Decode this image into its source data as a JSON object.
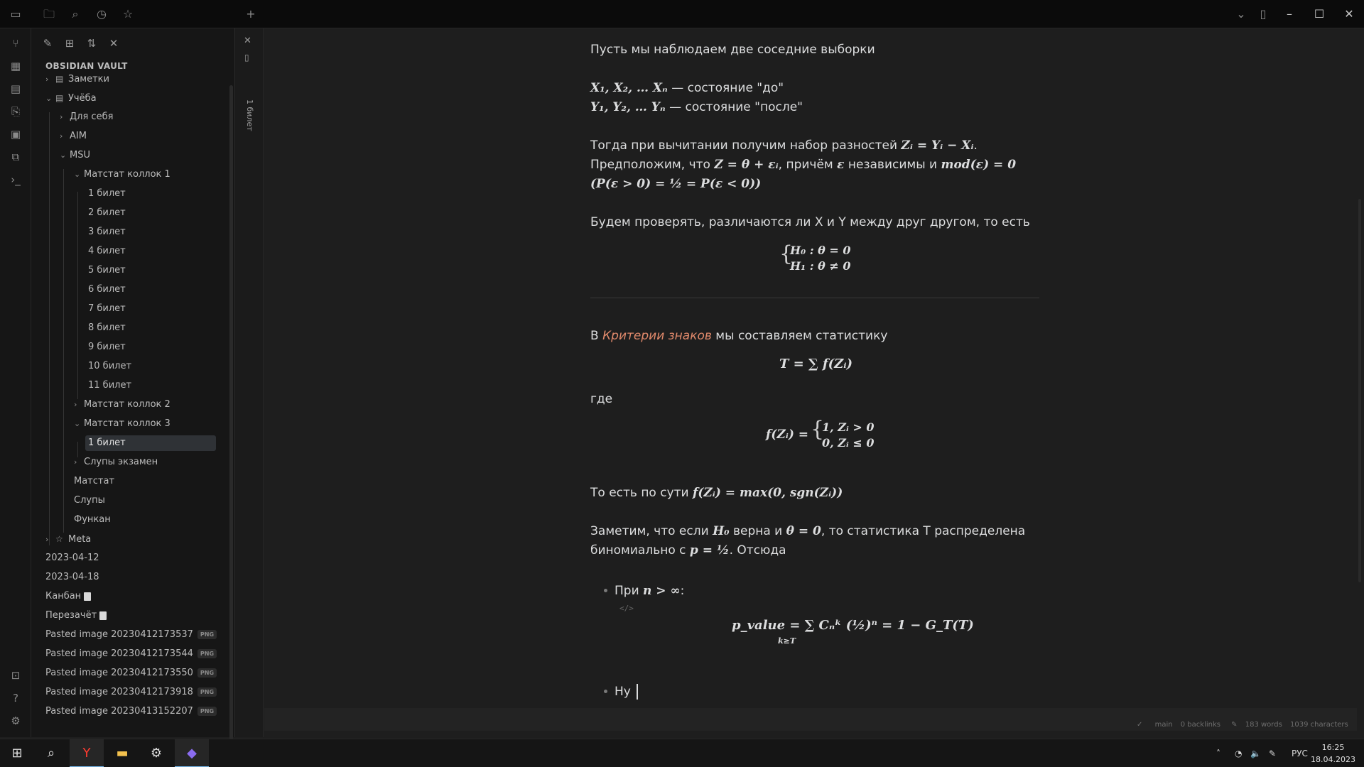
{
  "sidebar": {
    "vault_name": "OBSIDIAN VAULT",
    "tree": [
      {
        "label": "Заметки",
        "icon": "notebook-icon",
        "chev": "›"
      },
      {
        "label": "Учёба",
        "icon": "notebook-icon",
        "chev": "⌄"
      },
      {
        "label": "Для себя",
        "chev": "›"
      },
      {
        "label": "AIM",
        "chev": "›"
      },
      {
        "label": "MSU",
        "chev": "⌄"
      },
      {
        "label": "Матстат коллок 1",
        "chev": "⌄"
      },
      {
        "label": "1 билет"
      },
      {
        "label": "2 билет"
      },
      {
        "label": "3 билет"
      },
      {
        "label": "4 билет"
      },
      {
        "label": "5 билет"
      },
      {
        "label": "6 билет"
      },
      {
        "label": "7 билет"
      },
      {
        "label": "8 билет"
      },
      {
        "label": "9 билет"
      },
      {
        "label": "10 билет"
      },
      {
        "label": "11 билет"
      },
      {
        "label": "Матстат коллок 2",
        "chev": "›"
      },
      {
        "label": "Матстат коллок 3",
        "chev": "⌄"
      },
      {
        "label": "1 билет",
        "selected": true
      },
      {
        "label": "Слупы экзамен",
        "chev": "›"
      },
      {
        "label": "Матстат"
      },
      {
        "label": "Слупы"
      },
      {
        "label": "Функан"
      },
      {
        "label": "Meta",
        "icon": "star-icon",
        "chev": "›"
      },
      {
        "label": "2023-04-12"
      },
      {
        "label": "2023-04-18"
      },
      {
        "label": "Канбан"
      },
      {
        "label": "Перезачёт"
      },
      {
        "label": "Pasted image 20230412173537",
        "badge": "PNG"
      },
      {
        "label": "Pasted image 20230412173544",
        "badge": "PNG"
      },
      {
        "label": "Pasted image 20230412173550",
        "badge": "PNG"
      },
      {
        "label": "Pasted image 20230412173918",
        "badge": "PNG"
      },
      {
        "label": "Pasted image 20230413152207",
        "badge": "PNG"
      }
    ]
  },
  "tab": {
    "title": "1 билет"
  },
  "note": {
    "p1": "Пусть мы наблюдаем две соседние выборки",
    "x_seq": "X₁, X₂, … Xₙ",
    "x_text": " — состояние \"до\"",
    "y_seq": "Y₁, Y₂, … Yₙ",
    "y_text": " — состояние \"после\"",
    "p3a": "Тогда при вычитании получим набор разностей ",
    "p3a_math": "Zᵢ = Yᵢ − Xᵢ",
    "p3a_end": ".",
    "p3b_a": "Предположим, что ",
    "p3b_m1": "Z = θ + εᵢ",
    "p3b_b": ", причём ",
    "p3b_m2": "ε",
    "p3b_c": " независимы и ",
    "p3b_m3": "mod(ε) = 0",
    "p3c": "(P(ε > 0) = ½ = P(ε < 0))",
    "p4": "Будем проверять, различаются ли X и Y между друг другом, то есть",
    "h0": "H₀ :  θ = 0",
    "h1": "H₁ : θ ≠ 0",
    "p5_a": "В ",
    "p5_link": "Критерии знаков",
    "p5_b": " мы составляем статистику",
    "t_formula": "T = ∑ f(Zᵢ)",
    "where": "где",
    "f_lhs": "f(Zᵢ) =",
    "f_case1": "1, Zᵢ > 0",
    "f_case2": "0, Zᵢ ≤ 0",
    "p6_a": "То есть по сути ",
    "p6_m": "f(Zᵢ) = max(0, sgn(Zᵢ))",
    "p7_a": "Заметим, что если ",
    "p7_m1": "H₀",
    "p7_b": " верна и ",
    "p7_m2": "θ = 0",
    "p7_c": ", то статистика T распределена",
    "p7_d": "биномиально с ",
    "p7_m3": "p = ½",
    "p7_e": ". Отсюда",
    "bullet1_a": "При ",
    "bullet1_m": "n > ∞",
    "bullet1_b": ":",
    "code_hint": "</>",
    "pvalue": "p_value = ∑ Cₙᵏ (½)ⁿ = 1 − G_T(T)",
    "pvalue_sub": "k≥T",
    "bullet2": "Ну"
  },
  "status": {
    "branch": "main",
    "backlinks": "0 backlinks",
    "words": "183 words",
    "chars": "1039 characters"
  },
  "taskbar": {
    "lang": "РУС",
    "time": "16:25",
    "date": "18.04.2023"
  }
}
